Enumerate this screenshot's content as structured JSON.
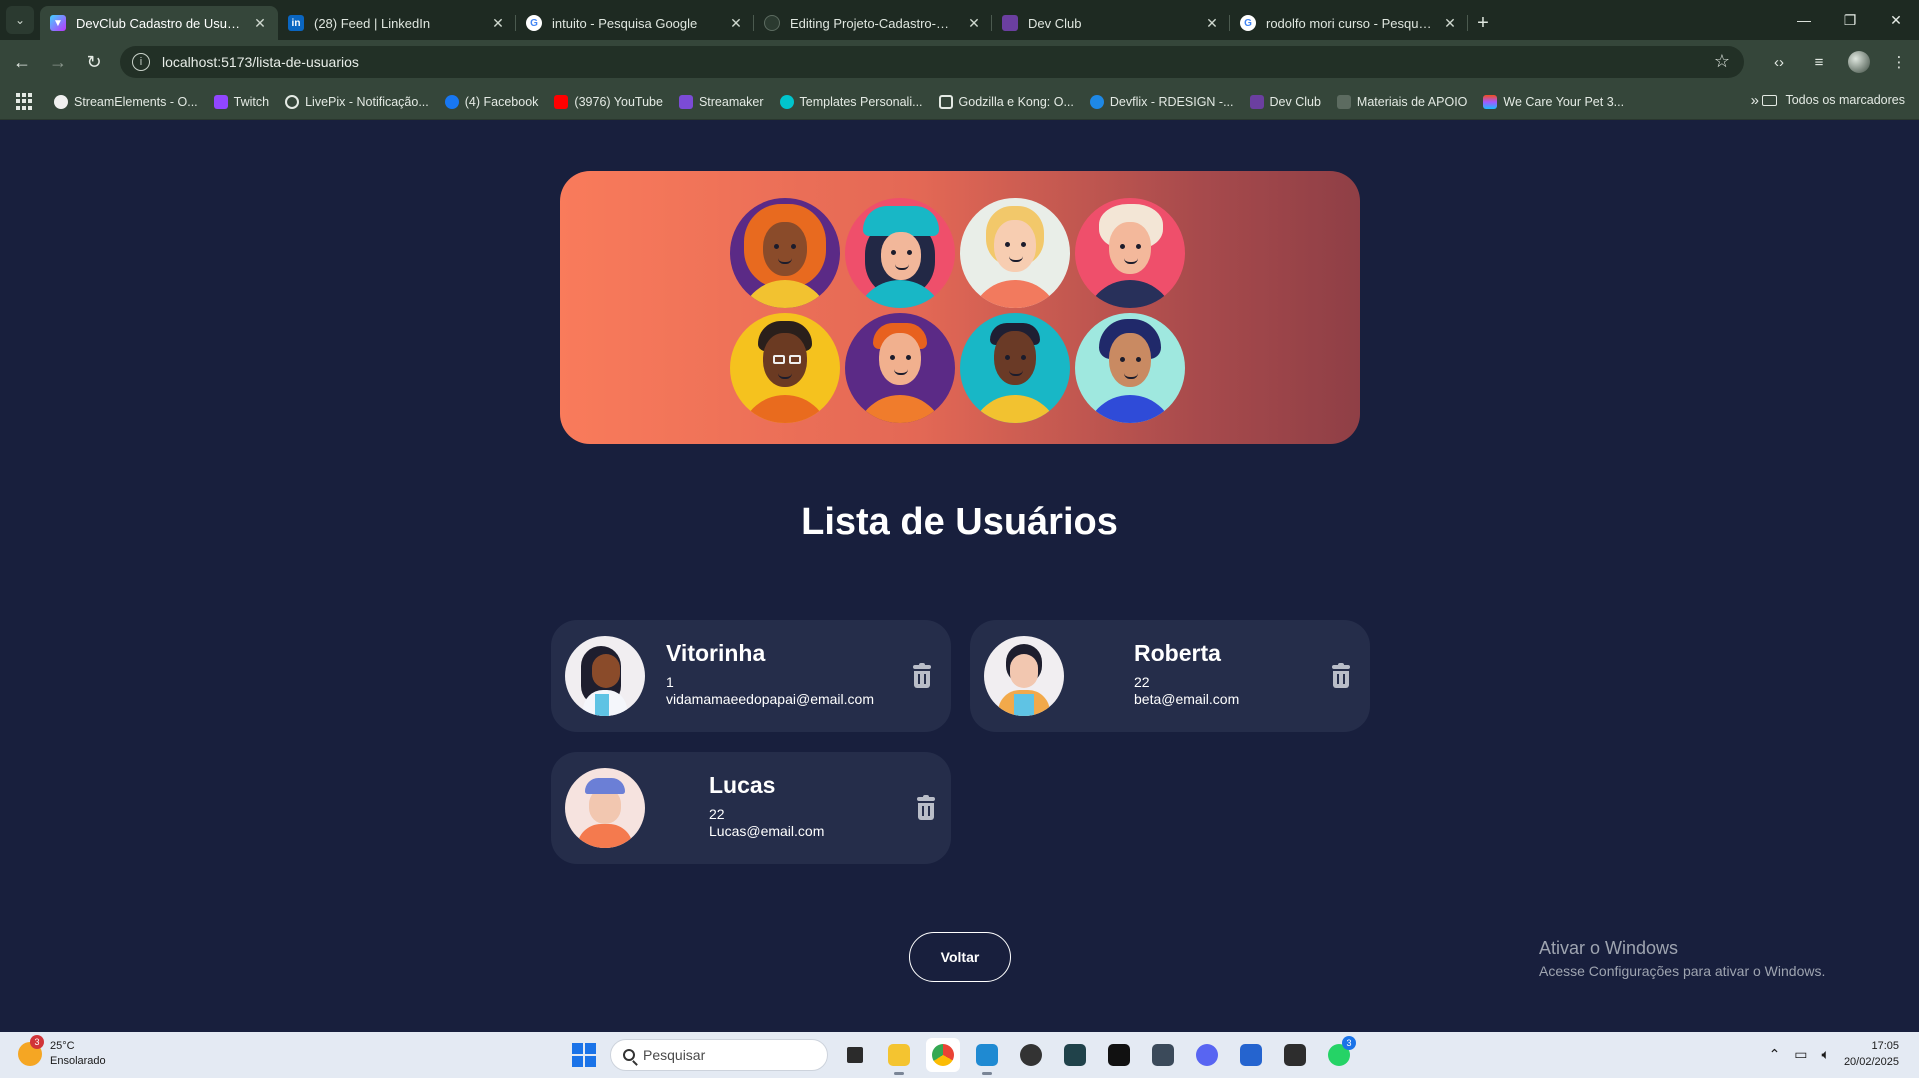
{
  "browser": {
    "tabs": [
      {
        "title": "DevClub Cadastro de Usuário",
        "favicon": "vite-icon",
        "active": true
      },
      {
        "title": "(28) Feed | LinkedIn",
        "favicon": "linkedin-icon"
      },
      {
        "title": "intuito - Pesquisa Google",
        "favicon": "google-icon"
      },
      {
        "title": "Editing Projeto-Cadastro-Usuar",
        "favicon": "github-icon"
      },
      {
        "title": "Dev Club",
        "favicon": "devclub-icon"
      },
      {
        "title": "rodolfo mori curso - Pesquisa G",
        "favicon": "google-icon"
      }
    ],
    "url": "localhost:5173/lista-de-usuarios",
    "bookmarks": [
      "StreamElements - O...",
      "Twitch",
      "LivePix - Notificação...",
      "(4) Facebook",
      "(3976) YouTube",
      "Streamaker",
      "Templates Personali...",
      "Godzilla e Kong: O...",
      "Devflix - RDESIGN -...",
      "Dev Club",
      "Materiais de APOIO",
      "We Care Your Pet 3..."
    ],
    "bookmarks_folder": "Todos os marcadores"
  },
  "page": {
    "title": "Lista de Usuários",
    "users": [
      {
        "name": "Vitorinha",
        "age": "1",
        "email": "vidamamaeedopapai@email.com"
      },
      {
        "name": "Roberta",
        "age": "22",
        "email": "beta@email.com"
      },
      {
        "name": "Lucas",
        "age": "22",
        "email": "Lucas@email.com"
      }
    ],
    "back_button": "Voltar"
  },
  "watermark": {
    "line1": "Ativar o Windows",
    "line2": "Acesse Configurações para ativar o Windows."
  },
  "taskbar": {
    "weather_temp": "25°C",
    "weather_desc": "Ensolarado",
    "weather_badge": "3",
    "search_placeholder": "Pesquisar",
    "whatsapp_badge": "3",
    "time": "17:05",
    "date": "20/02/2025"
  },
  "colors": {
    "page_bg": "#181f3d",
    "card_bg": "#252d4a",
    "hero_gradient_start": "#f97b5b",
    "hero_gradient_end": "#8f3f46"
  }
}
